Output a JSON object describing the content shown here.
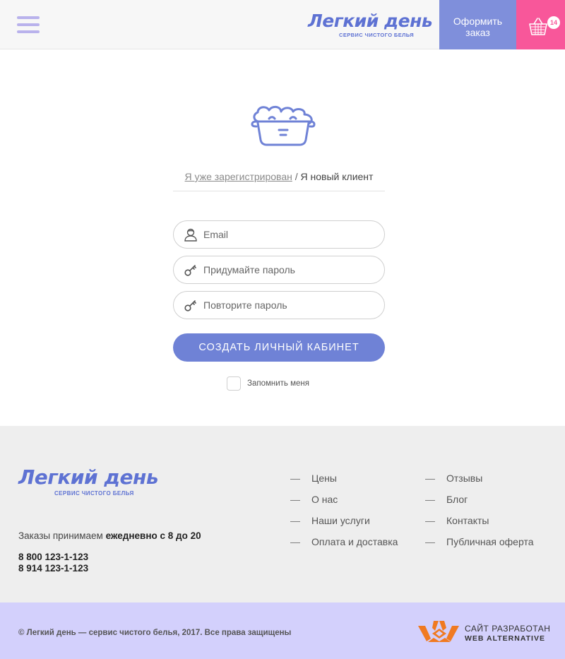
{
  "header": {
    "logo_title": "Легкий день",
    "logo_subtitle": "СЕРВИС ЧИСТОГО БЕЛЬЯ",
    "order_button_line1": "Оформить",
    "order_button_line2": "заказ",
    "cart_count": "14",
    "menu_icon": "hamburger-menu-icon",
    "cart_icon": "basket-icon"
  },
  "auth": {
    "tab_login": "Я уже зарегистрирован",
    "tab_separator": "/",
    "tab_register": "Я новый клиент",
    "email_placeholder": "Email",
    "password_placeholder": "Придумайте пароль",
    "password_repeat_placeholder": "Повторите пароль",
    "submit_label": "СОЗДАТЬ ЛИЧНЫЙ КАБИНЕТ",
    "remember_label": "Запомнить меня",
    "remember_checked": false
  },
  "footer": {
    "logo_title": "Легкий день",
    "logo_subtitle": "СЕРВИС ЧИСТОГО БЕЛЬЯ",
    "hours_prefix": "Заказы  принимаем",
    "hours_bold": "ежедневно с 8 до 20",
    "phone_1": "8 800 123-1-123",
    "phone_2": "8 914  123-1-123",
    "menu_col1": [
      "Цены",
      "О нас",
      "Наши услуги",
      "Оплата и доставка"
    ],
    "menu_col2": [
      "Отзывы",
      "Блог",
      "Контакты",
      "Публичная оферта"
    ],
    "dash": "—"
  },
  "bottom_bar": {
    "copyright": "© Легкий день — сервис чистого белья, 2017. Все права защищены",
    "developer_line1": "САЙТ РАЗРАБОТАН",
    "developer_line2": "WEB ALTERNATIVE"
  },
  "colors": {
    "accent_blue": "#6f82d6",
    "order_button": "#7f8fdb",
    "cart_pink": "#f8579a",
    "bottom_bar": "#d3d0fc",
    "dev_logo_orange": "#f07a21"
  }
}
